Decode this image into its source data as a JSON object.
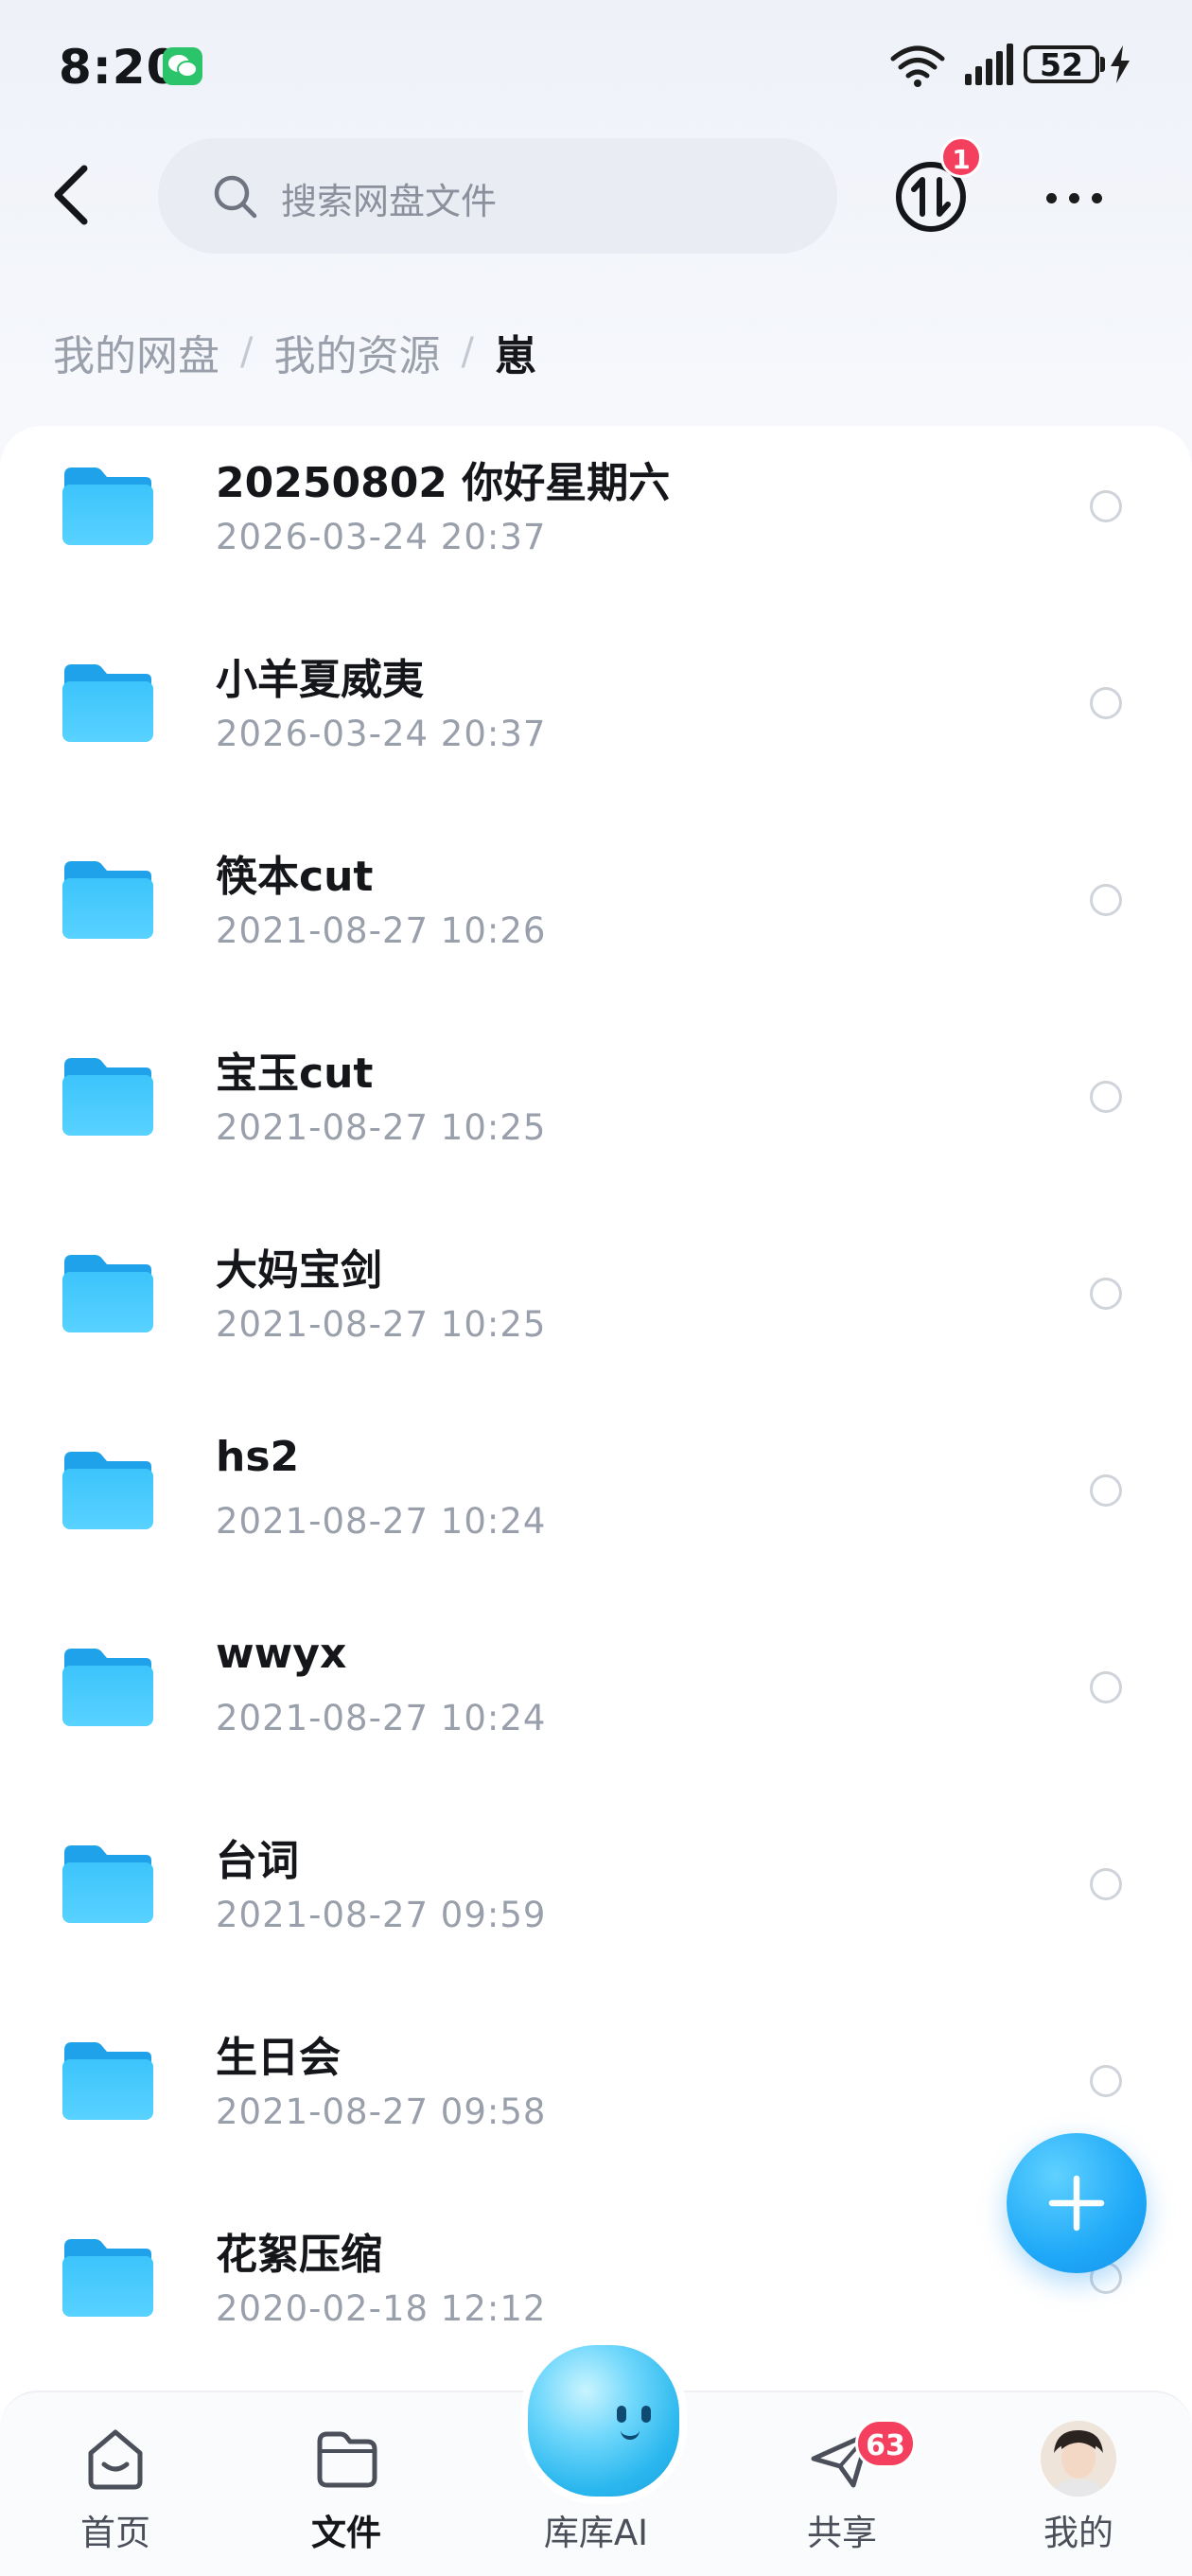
{
  "status_bar": {
    "time": "8:20",
    "battery": "52"
  },
  "search": {
    "placeholder": "搜索网盘文件"
  },
  "transfer": {
    "badge": "1"
  },
  "breadcrumb": {
    "root": "我的网盘",
    "middle": "我的资源",
    "current": "崽",
    "separator": "/"
  },
  "files": [
    {
      "name": "20250802 你好星期六",
      "date": "2026-03-24  20:37"
    },
    {
      "name": "小羊夏威夷",
      "date": "2026-03-24  20:37"
    },
    {
      "name": "筷本cut",
      "date": "2021-08-27  10:26"
    },
    {
      "name": "宝玉cut",
      "date": "2021-08-27  10:25"
    },
    {
      "name": "大妈宝剑",
      "date": "2021-08-27  10:25"
    },
    {
      "name": "hs2",
      "date": "2021-08-27  10:24"
    },
    {
      "name": "wwyx",
      "date": "2021-08-27  10:24"
    },
    {
      "name": "台词",
      "date": "2021-08-27  09:59"
    },
    {
      "name": "生日会",
      "date": "2021-08-27  09:58"
    },
    {
      "name": "花絮压缩",
      "date": "2020-02-18  12:12"
    }
  ],
  "nav": {
    "home": "首页",
    "files": "文件",
    "ai": "库库AI",
    "share": "共享",
    "share_badge": "63",
    "me": "我的"
  },
  "colors": {
    "accent": "#1fa9f8",
    "badge": "#f43f5e",
    "folder": "#2fb6f5"
  },
  "icons": [
    "search-icon",
    "transfer-icon",
    "more-icon",
    "folder-icon",
    "add-icon",
    "home-icon",
    "files-nav-icon",
    "share-icon",
    "avatar"
  ]
}
